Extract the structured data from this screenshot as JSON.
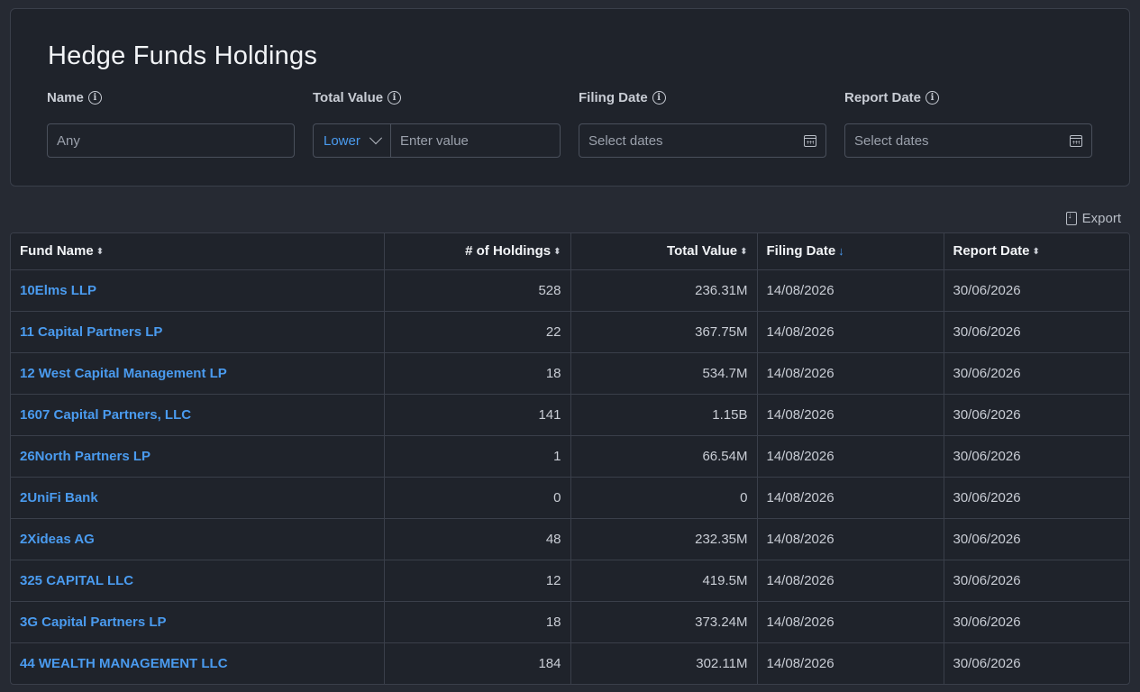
{
  "page": {
    "title": "Hedge Funds Holdings"
  },
  "filters": {
    "name": {
      "label": "Name",
      "placeholder": "Any"
    },
    "total_value": {
      "label": "Total Value",
      "operator": "Lower",
      "placeholder": "Enter value"
    },
    "filing_date": {
      "label": "Filing Date",
      "placeholder": "Select dates"
    },
    "report_date": {
      "label": "Report Date",
      "placeholder": "Select dates"
    }
  },
  "toolbar": {
    "export_label": "Export"
  },
  "table": {
    "columns": [
      "Fund Name",
      "# of Holdings",
      "Total Value",
      "Filing Date",
      "Report Date"
    ],
    "sorted_column": "Filing Date",
    "rows": [
      {
        "fund": "10Elms LLP",
        "holdings": "528",
        "value": "236.31M",
        "filing": "14/08/2026",
        "report": "30/06/2026"
      },
      {
        "fund": "11 Capital Partners LP",
        "holdings": "22",
        "value": "367.75M",
        "filing": "14/08/2026",
        "report": "30/06/2026"
      },
      {
        "fund": "12 West Capital Management LP",
        "holdings": "18",
        "value": "534.7M",
        "filing": "14/08/2026",
        "report": "30/06/2026"
      },
      {
        "fund": "1607 Capital Partners, LLC",
        "holdings": "141",
        "value": "1.15B",
        "filing": "14/08/2026",
        "report": "30/06/2026"
      },
      {
        "fund": "26North Partners LP",
        "holdings": "1",
        "value": "66.54M",
        "filing": "14/08/2026",
        "report": "30/06/2026"
      },
      {
        "fund": "2UniFi Bank",
        "holdings": "0",
        "value": "0",
        "filing": "14/08/2026",
        "report": "30/06/2026"
      },
      {
        "fund": "2Xideas AG",
        "holdings": "48",
        "value": "232.35M",
        "filing": "14/08/2026",
        "report": "30/06/2026"
      },
      {
        "fund": "325 CAPITAL LLC",
        "holdings": "12",
        "value": "419.5M",
        "filing": "14/08/2026",
        "report": "30/06/2026"
      },
      {
        "fund": "3G Capital Partners LP",
        "holdings": "18",
        "value": "373.24M",
        "filing": "14/08/2026",
        "report": "30/06/2026"
      },
      {
        "fund": "44 WEALTH MANAGEMENT LLC",
        "holdings": "184",
        "value": "302.11M",
        "filing": "14/08/2026",
        "report": "30/06/2026"
      }
    ]
  },
  "colors": {
    "accent": "#4a9bef",
    "background": "#262a33",
    "card": "#1f232b"
  }
}
